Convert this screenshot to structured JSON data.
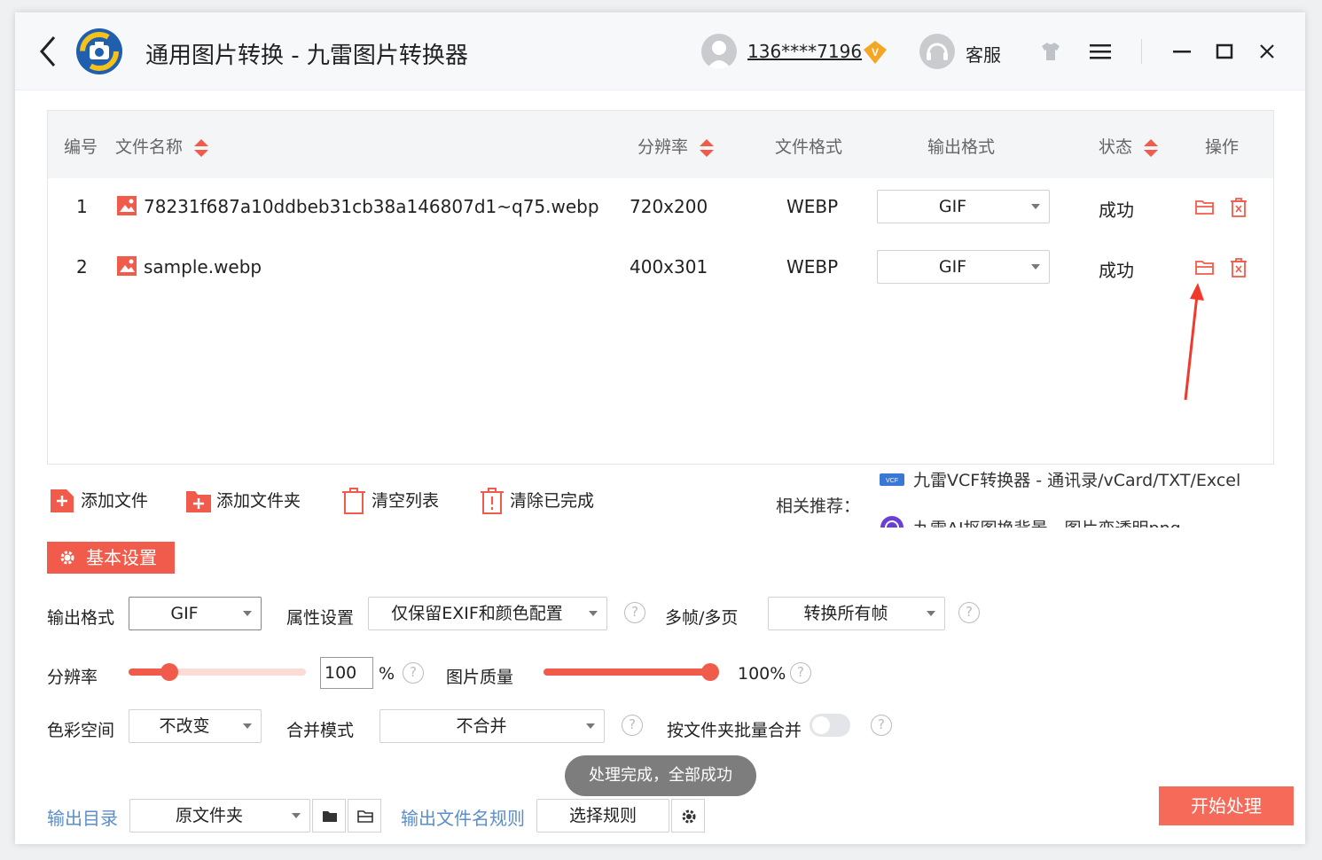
{
  "app": {
    "title": "通用图片转换 - 九雷图片转换器",
    "user_phone": "136****7196",
    "service_label": "客服"
  },
  "table": {
    "headers": {
      "index": "编号",
      "filename": "文件名称",
      "resolution": "分辨率",
      "file_format": "文件格式",
      "output_format": "输出格式",
      "status": "状态",
      "action": "操作"
    },
    "rows": [
      {
        "index": "1",
        "filename": "78231f687a10ddbeb31cb38a146807d1~q75.webp",
        "resolution": "720x200",
        "file_format": "WEBP",
        "output_format": "GIF",
        "status": "成功"
      },
      {
        "index": "2",
        "filename": "sample.webp",
        "resolution": "400x301",
        "file_format": "WEBP",
        "output_format": "GIF",
        "status": "成功"
      }
    ]
  },
  "toolbar": {
    "add_file": "添加文件",
    "add_folder": "添加文件夹",
    "clear_list": "清空列表",
    "clear_done": "清除已完成"
  },
  "recommend": {
    "label": "相关推荐：",
    "items": [
      "九雷VCF转换器 - 通讯录/vCard/TXT/Excel",
      "九雷AI抠图换背景 - 图片变透明png"
    ]
  },
  "settings": {
    "basic_label": "基本设置",
    "output_format_label": "输出格式",
    "output_format_value": "GIF",
    "attr_label": "属性设置",
    "attr_value": "仅保留EXIF和颜色配置",
    "multiframe_label": "多帧/多页",
    "multiframe_value": "转换所有帧",
    "resolution_label": "分辨率",
    "resolution_value": "100",
    "resolution_unit": "%",
    "resolution_slider_percent": 23,
    "quality_label": "图片质量",
    "quality_value": "100%",
    "quality_slider_percent": 100,
    "colorspace_label": "色彩空间",
    "colorspace_value": "不改变",
    "merge_label": "合并模式",
    "merge_value": "不合并",
    "batch_merge_label": "按文件夹批量合并",
    "batch_merge_on": false,
    "help_glyph": "?"
  },
  "toast": "处理完成，全部成功",
  "output": {
    "dir_label": "输出目录",
    "dir_value": "原文件夹",
    "rule_label": "输出文件名规则",
    "rule_value": "选择规则",
    "start_label": "开始处理"
  },
  "colors": {
    "accent": "#f05b4b",
    "start": "#f66a59",
    "link": "#5b8ec9"
  }
}
